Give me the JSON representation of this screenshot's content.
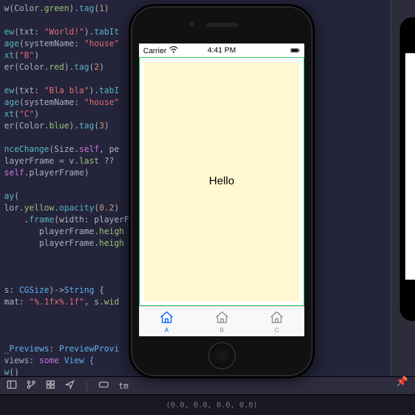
{
  "code_lines": [
    {
      "segments": [
        {
          "t": "w",
          "v": ".id"
        },
        {
          "t": "(Color.",
          "v": ".id"
        },
        {
          "t": "green",
          "v": ".prop"
        },
        {
          "t": ").",
          "v": ".id"
        },
        {
          "t": "tag",
          "v": ".fn"
        },
        {
          "t": "(",
          "v": ".id"
        },
        {
          "t": "1",
          "v": ".num"
        },
        {
          "t": ")",
          "v": ".id"
        }
      ]
    },
    {
      "segments": []
    },
    {
      "segments": [
        {
          "t": "ew",
          "v": ".fn"
        },
        {
          "t": "(txt: ",
          "v": ".id"
        },
        {
          "t": "\"World!\"",
          "v": ".str"
        },
        {
          "t": ").",
          "v": ".id"
        },
        {
          "t": "tabIt",
          "v": ".fn"
        }
      ]
    },
    {
      "segments": [
        {
          "t": "age",
          "v": ".fn"
        },
        {
          "t": "(systemName: ",
          "v": ".id"
        },
        {
          "t": "\"house\"",
          "v": ".str"
        }
      ]
    },
    {
      "segments": [
        {
          "t": "xt",
          "v": ".fn"
        },
        {
          "t": "(",
          "v": ".id"
        },
        {
          "t": "\"B\"",
          "v": ".str"
        },
        {
          "t": ")",
          "v": ".id"
        }
      ]
    },
    {
      "segments": [
        {
          "t": "er",
          "v": ".id"
        },
        {
          "t": "(Color.",
          "v": ".id"
        },
        {
          "t": "red",
          "v": ".prop"
        },
        {
          "t": ").",
          "v": ".id"
        },
        {
          "t": "tag",
          "v": ".fn"
        },
        {
          "t": "(",
          "v": ".id"
        },
        {
          "t": "2",
          "v": ".num"
        },
        {
          "t": ")",
          "v": ".id"
        }
      ]
    },
    {
      "segments": []
    },
    {
      "segments": [
        {
          "t": "ew",
          "v": ".fn"
        },
        {
          "t": "(txt: ",
          "v": ".id"
        },
        {
          "t": "\"Bla bla\"",
          "v": ".str"
        },
        {
          "t": ").",
          "v": ".id"
        },
        {
          "t": "tabI",
          "v": ".fn"
        }
      ]
    },
    {
      "segments": [
        {
          "t": "age",
          "v": ".fn"
        },
        {
          "t": "(systemName: ",
          "v": ".id"
        },
        {
          "t": "\"house\"",
          "v": ".str"
        }
      ]
    },
    {
      "segments": [
        {
          "t": "xt",
          "v": ".fn"
        },
        {
          "t": "(",
          "v": ".id"
        },
        {
          "t": "\"C\"",
          "v": ".str"
        },
        {
          "t": ")",
          "v": ".id"
        }
      ]
    },
    {
      "segments": [
        {
          "t": "er",
          "v": ".id"
        },
        {
          "t": "(Color.",
          "v": ".id"
        },
        {
          "t": "blue",
          "v": ".prop"
        },
        {
          "t": ").",
          "v": ".id"
        },
        {
          "t": "tag",
          "v": ".fn"
        },
        {
          "t": "(",
          "v": ".id"
        },
        {
          "t": "3",
          "v": ".num"
        },
        {
          "t": ")",
          "v": ".id"
        }
      ]
    },
    {
      "segments": []
    },
    {
      "segments": [
        {
          "t": "nceChange",
          "v": ".fn"
        },
        {
          "t": "(Size.",
          "v": ".id"
        },
        {
          "t": "self",
          "v": ".kw"
        },
        {
          "t": ", pe",
          "v": ".id"
        }
      ]
    },
    {
      "segments": [
        {
          "t": "layerFrame",
          "v": ".id"
        },
        {
          "t": " = v.",
          "v": ".id"
        },
        {
          "t": "last",
          "v": ".prop"
        },
        {
          "t": " ?? ",
          "v": ".op"
        }
      ]
    },
    {
      "segments": [
        {
          "t": "self",
          "v": ".kw"
        },
        {
          "t": ".playerFrame)",
          "v": ".id"
        }
      ]
    },
    {
      "segments": []
    },
    {
      "segments": [
        {
          "t": "ay",
          "v": ".fn"
        },
        {
          "t": "(",
          "v": ".id"
        }
      ]
    },
    {
      "segments": [
        {
          "t": "lor.",
          "v": ".id"
        },
        {
          "t": "yellow",
          "v": ".prop"
        },
        {
          "t": ".",
          "v": ".id"
        },
        {
          "t": "opacity",
          "v": ".fn"
        },
        {
          "t": "(",
          "v": ".id"
        },
        {
          "t": "0.2",
          "v": ".num"
        },
        {
          "t": ")",
          "v": ".id"
        }
      ]
    },
    {
      "segments": [
        {
          "t": "    .",
          "v": ".id"
        },
        {
          "t": "frame",
          "v": ".fn"
        },
        {
          "t": "(width: playerF",
          "v": ".id"
        }
      ]
    },
    {
      "segments": [
        {
          "t": "       playerFrame.",
          "v": ".id"
        },
        {
          "t": "heigh",
          "v": ".prop"
        }
      ]
    },
    {
      "segments": [
        {
          "t": "       playerFrame.",
          "v": ".id"
        },
        {
          "t": "heigh",
          "v": ".prop"
        }
      ]
    },
    {
      "segments": []
    },
    {
      "segments": []
    },
    {
      "segments": []
    },
    {
      "segments": [
        {
          "t": "s: ",
          "v": ".id"
        },
        {
          "t": "CGSize",
          "v": ".type"
        },
        {
          "t": ")->",
          "v": ".id"
        },
        {
          "t": "String",
          "v": ".type"
        },
        {
          "t": " {",
          "v": ".id"
        }
      ]
    },
    {
      "segments": [
        {
          "t": "mat: ",
          "v": ".id"
        },
        {
          "t": "\"%.1fx%.1f\"",
          "v": ".str"
        },
        {
          "t": ", s.",
          "v": ".id"
        },
        {
          "t": "wid",
          "v": ".prop"
        }
      ]
    },
    {
      "segments": []
    },
    {
      "segments": []
    },
    {
      "segments": []
    },
    {
      "segments": [
        {
          "t": "_Previews",
          "v": ".type"
        },
        {
          "t": ": ",
          "v": ".id"
        },
        {
          "t": "PreviewProvi",
          "v": ".type"
        }
      ]
    },
    {
      "segments": [
        {
          "t": "views",
          "v": ".id"
        },
        {
          "t": ": ",
          "v": ".id"
        },
        {
          "t": "some",
          "v": ".kw"
        },
        {
          "t": " View {",
          "v": ".type"
        }
      ]
    },
    {
      "segments": [
        {
          "t": "w",
          "v": ".fn"
        },
        {
          "t": "()",
          "v": ".id"
        }
      ]
    }
  ],
  "toolbar_tab": "tm",
  "status_text": "(0.0, 0.0, 0.0, 0.0)",
  "phone": {
    "carrier": "Carrier",
    "time": "4:41 PM",
    "content_text": "Hello",
    "tabs": [
      {
        "label": "A",
        "active": true
      },
      {
        "label": "B",
        "active": false
      },
      {
        "label": "C",
        "active": false
      }
    ]
  }
}
